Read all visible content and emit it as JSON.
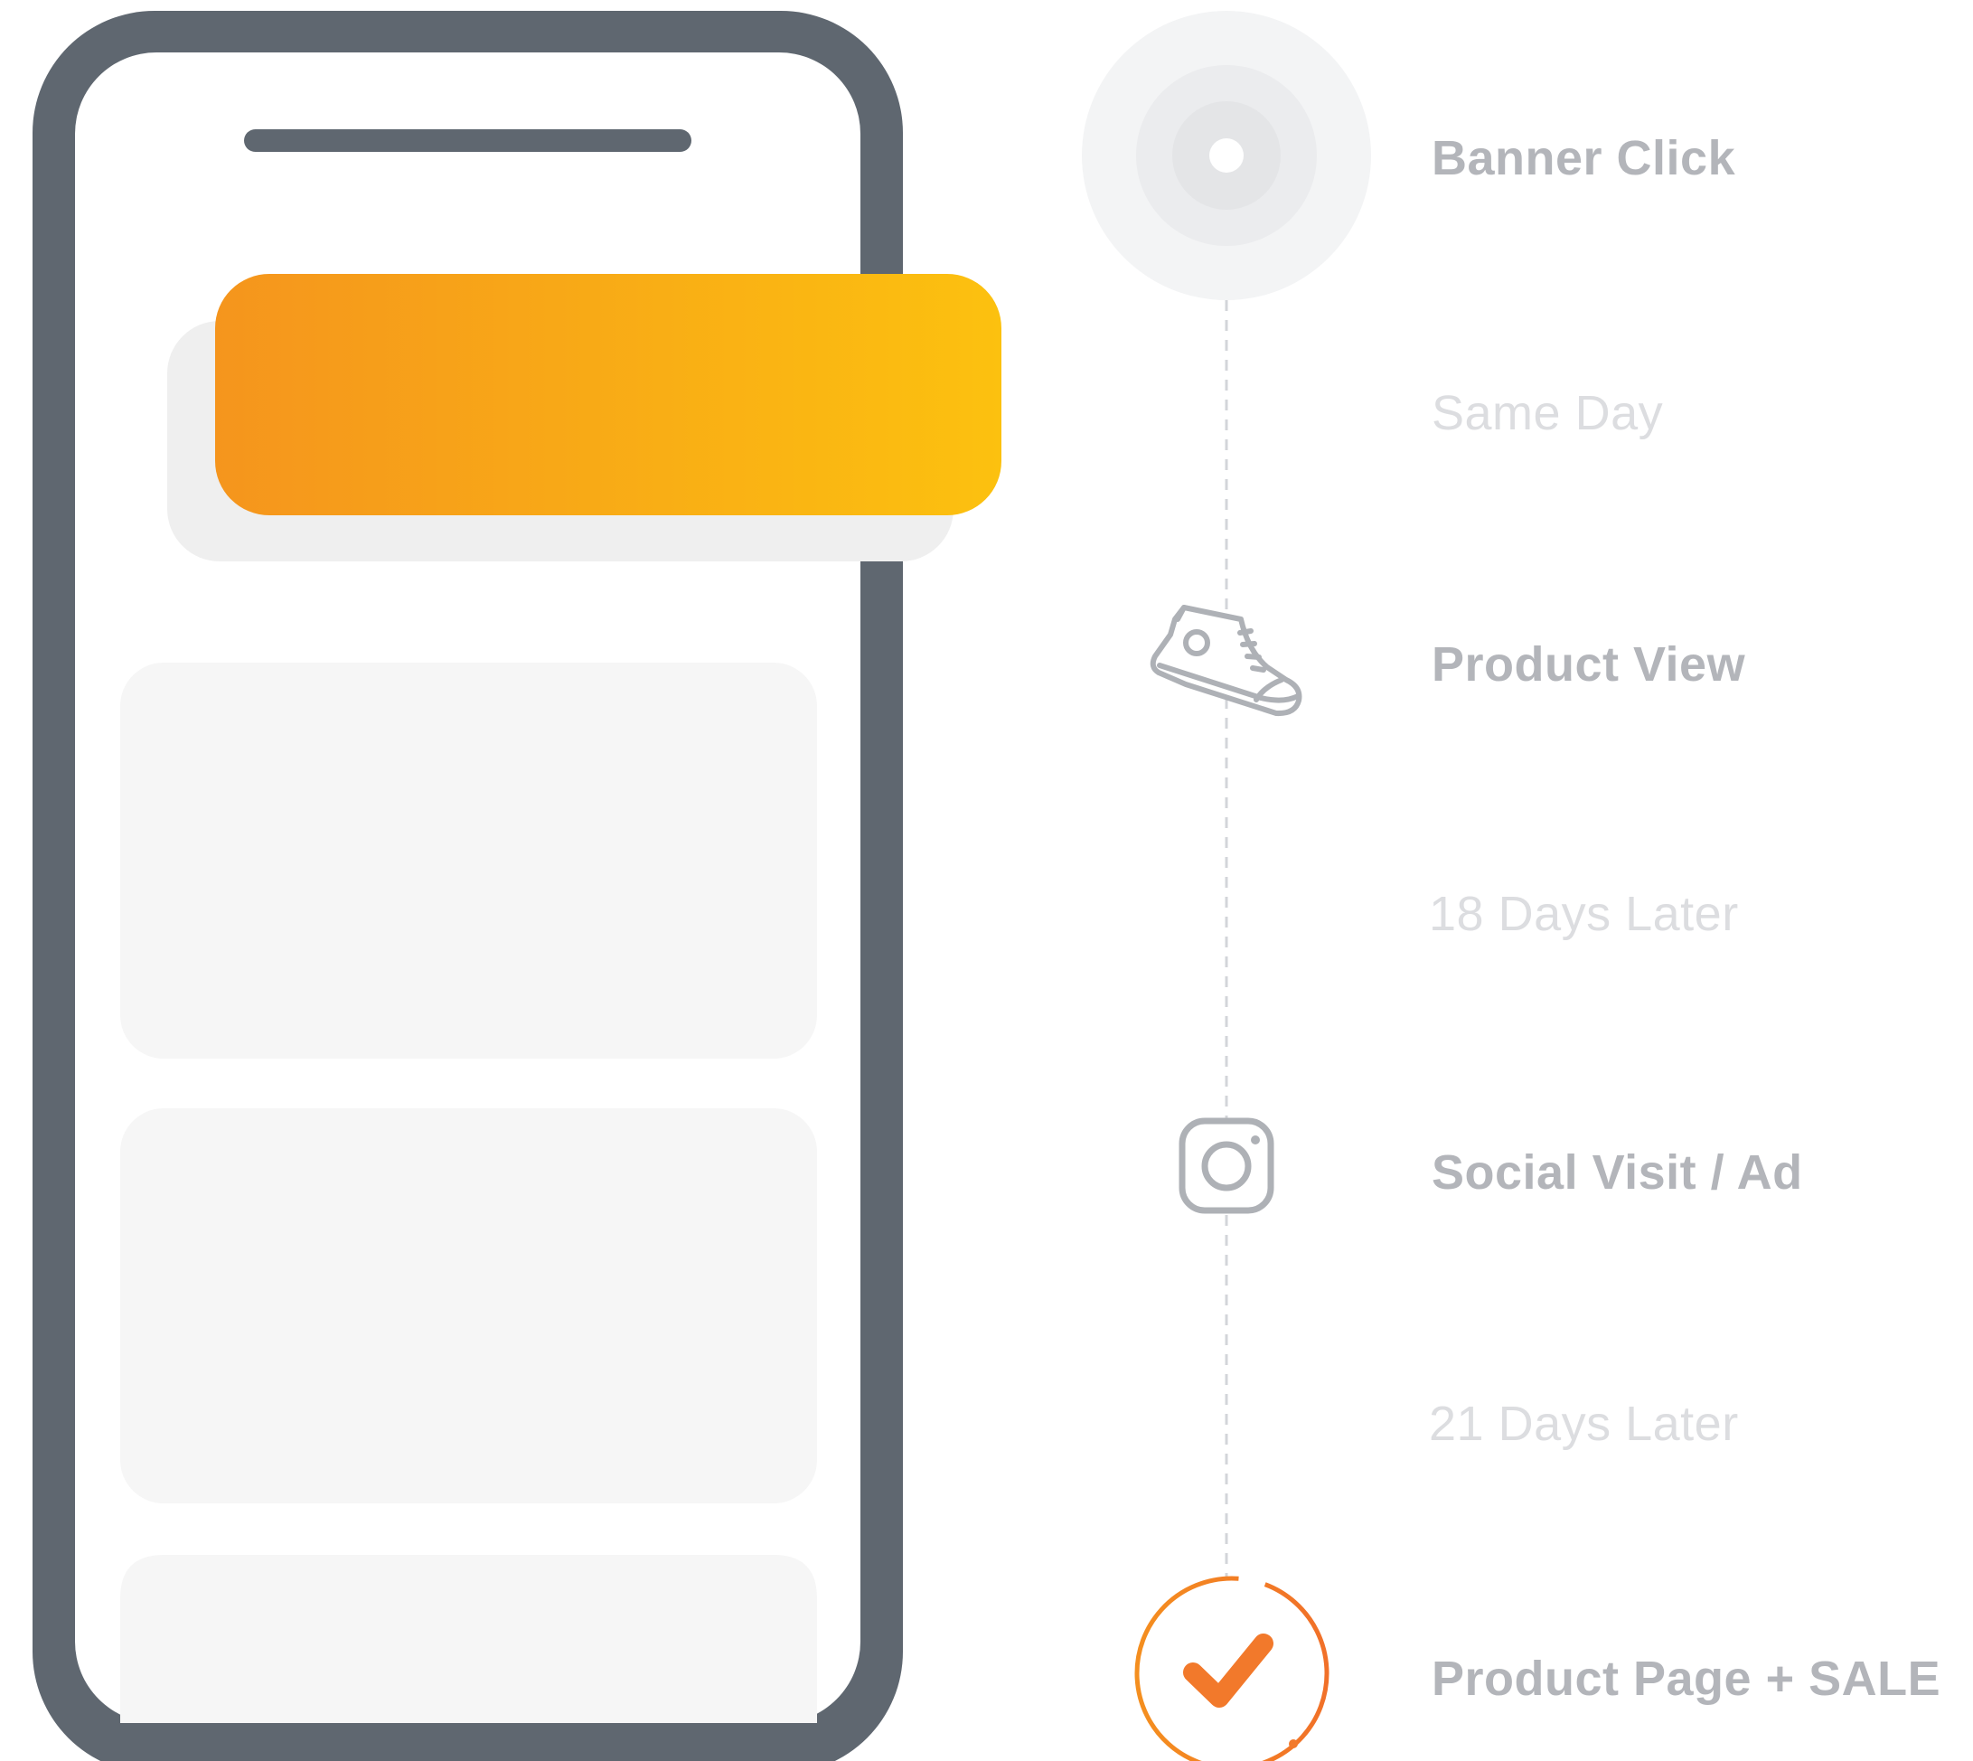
{
  "colors": {
    "phone_frame": "#5f6770",
    "phone_screen": "#ffffff",
    "banner_gradient_start": "#f5951d",
    "banner_gradient_end": "#fcc10f",
    "banner_shadow": "#efefef",
    "content_card": "#f6f6f6",
    "timeline_line": "#d3d5d9",
    "event_text": "#b3b5ba",
    "interval_text": "#dcdde0",
    "icon_stroke": "#aeb1b6",
    "sale_accent": "#f2792b"
  },
  "timeline": {
    "steps": [
      {
        "label": "Banner Click",
        "icon": "target-click-icon"
      },
      {
        "label": "Product View",
        "icon": "sneaker-icon"
      },
      {
        "label": "Social Visit / Ad",
        "icon": "instagram-icon"
      },
      {
        "label": "Product Page + SALE",
        "icon": "checkmark-circle-icon"
      }
    ],
    "intervals": [
      {
        "label": "Same Day"
      },
      {
        "label": "18 Days Later"
      },
      {
        "label": "21 Days Later"
      }
    ]
  }
}
